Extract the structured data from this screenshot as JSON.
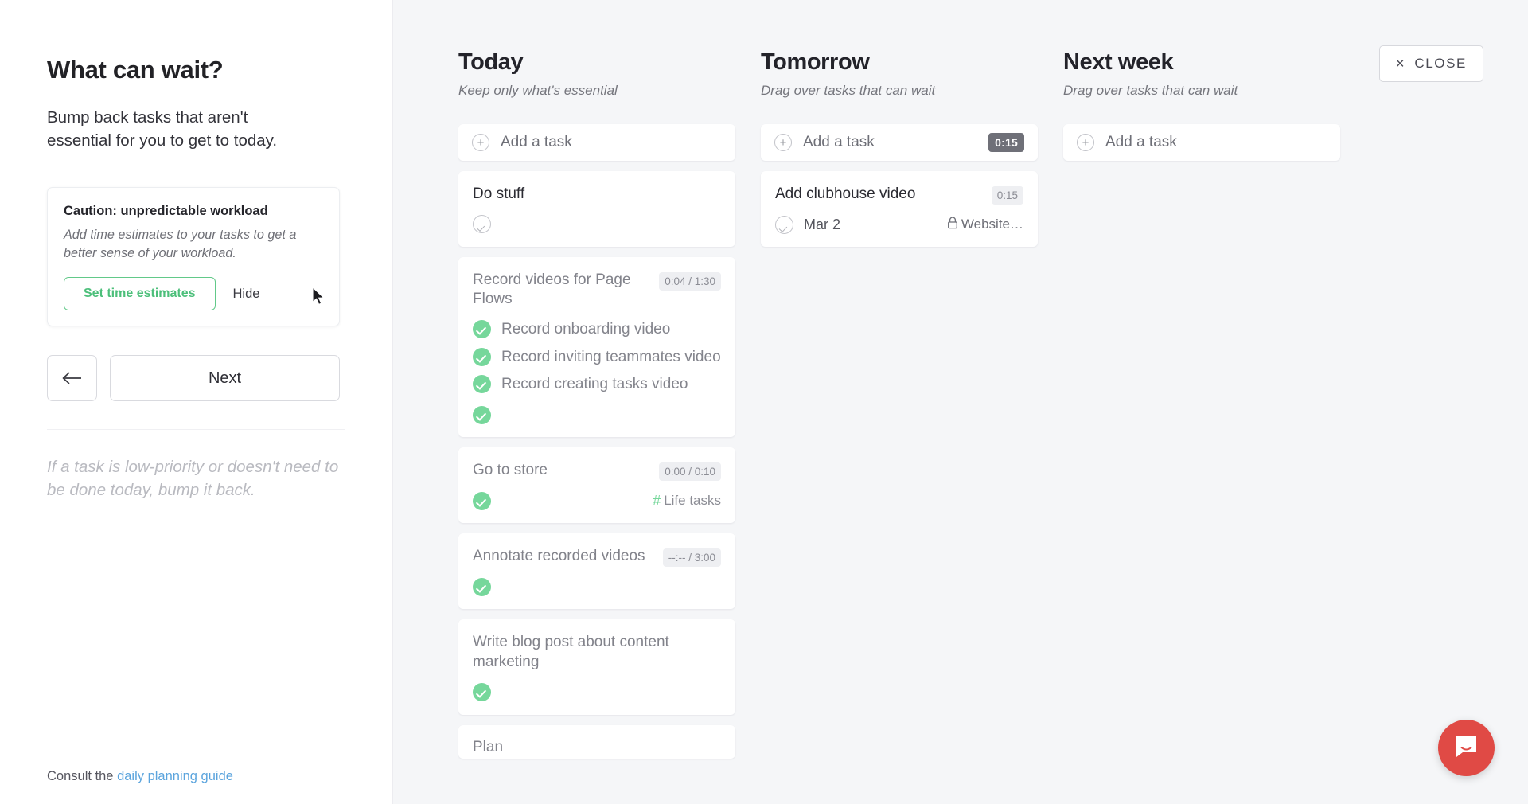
{
  "left_panel": {
    "title": "What can wait?",
    "description": "Bump back tasks that aren't essential for you to get to today.",
    "caution": {
      "title": "Caution: unpredictable workload",
      "description": "Add time estimates to your tasks to get a better sense of your workload.",
      "primary_label": "Set time estimates",
      "secondary_label": "Hide",
      "accent_color": "#4cbf7a"
    },
    "nav": {
      "back_label": "←",
      "next_label": "Next"
    },
    "hint": "If a task is low-priority or doesn't need to be done today, bump it back.",
    "footer": {
      "prefix": "Consult the ",
      "link_label": "daily planning guide",
      "link_color": "#5ba4dd"
    }
  },
  "board": {
    "close_label": "CLOSE",
    "close_icon": "×",
    "columns": [
      {
        "title": "Today",
        "subtitle": "Keep only what's essential",
        "add_task_label": "Add a task",
        "add_task_badge": null,
        "tasks": [
          {
            "title": "Do stuff",
            "muted": false,
            "time": null,
            "check": "empty",
            "date": null,
            "tag": null,
            "lock": null,
            "subtasks": []
          },
          {
            "title": "Record videos for Page Flows",
            "muted": true,
            "time": "0:04 / 1:30",
            "check": "done",
            "date": null,
            "tag": null,
            "lock": null,
            "subtasks": [
              "Record onboarding video",
              "Record inviting teammates video",
              "Record creating tasks video"
            ]
          },
          {
            "title": "Go to store",
            "muted": true,
            "time": "0:00 / 0:10",
            "check": "done",
            "date": null,
            "tag": "Life tasks",
            "lock": null,
            "subtasks": []
          },
          {
            "title": "Annotate recorded videos",
            "muted": true,
            "time": "--:-- / 3:00",
            "check": "done",
            "date": null,
            "tag": null,
            "lock": null,
            "subtasks": []
          },
          {
            "title": "Write blog post about content marketing",
            "muted": true,
            "time": null,
            "check": "done",
            "date": null,
            "tag": null,
            "lock": null,
            "subtasks": []
          }
        ],
        "partial_task_title": "Plan"
      },
      {
        "title": "Tomorrow",
        "subtitle": "Drag over tasks that can wait",
        "add_task_label": "Add a task",
        "add_task_badge": "0:15",
        "tasks": [
          {
            "title": "Add clubhouse video",
            "muted": false,
            "time": "0:15",
            "check": "empty",
            "date": "Mar 2",
            "tag": null,
            "lock": "Website…",
            "subtasks": []
          }
        ],
        "partial_task_title": null
      },
      {
        "title": "Next week",
        "subtitle": "Drag over tasks that can wait",
        "add_task_label": "Add a task",
        "add_task_badge": null,
        "tasks": [],
        "partial_task_title": null
      }
    ]
  },
  "chat_widget": {
    "icon": "chat-bubble-icon",
    "color": "#e04a45"
  }
}
